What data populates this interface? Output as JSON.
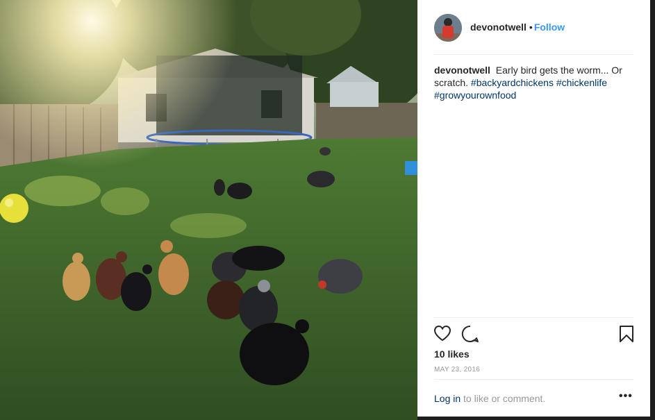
{
  "post": {
    "image_alt": "Chickens foraging in a grassy backyard with a shed and trampoline at sunrise",
    "username": "devonotwell",
    "separator": "•",
    "follow_label": "Follow",
    "caption": {
      "username": "devonotwell",
      "text": "Early bird gets the worm... Or scratch.",
      "hashtags": [
        "#backyardchickens",
        "#chickenlife",
        "#growyourownfood"
      ]
    },
    "likes": "10 likes",
    "date": "MAY 23, 2016",
    "login_link": "Log in",
    "login_suffix": " to like or comment.",
    "more_label": "•••"
  },
  "icons": {
    "like": "heart-icon",
    "comment": "comment-bubble-icon",
    "save": "bookmark-icon",
    "more": "more-options-icon"
  },
  "colors": {
    "link_blue": "#3897f0",
    "hashtag": "#003569",
    "text": "#262626",
    "muted": "#999999"
  }
}
